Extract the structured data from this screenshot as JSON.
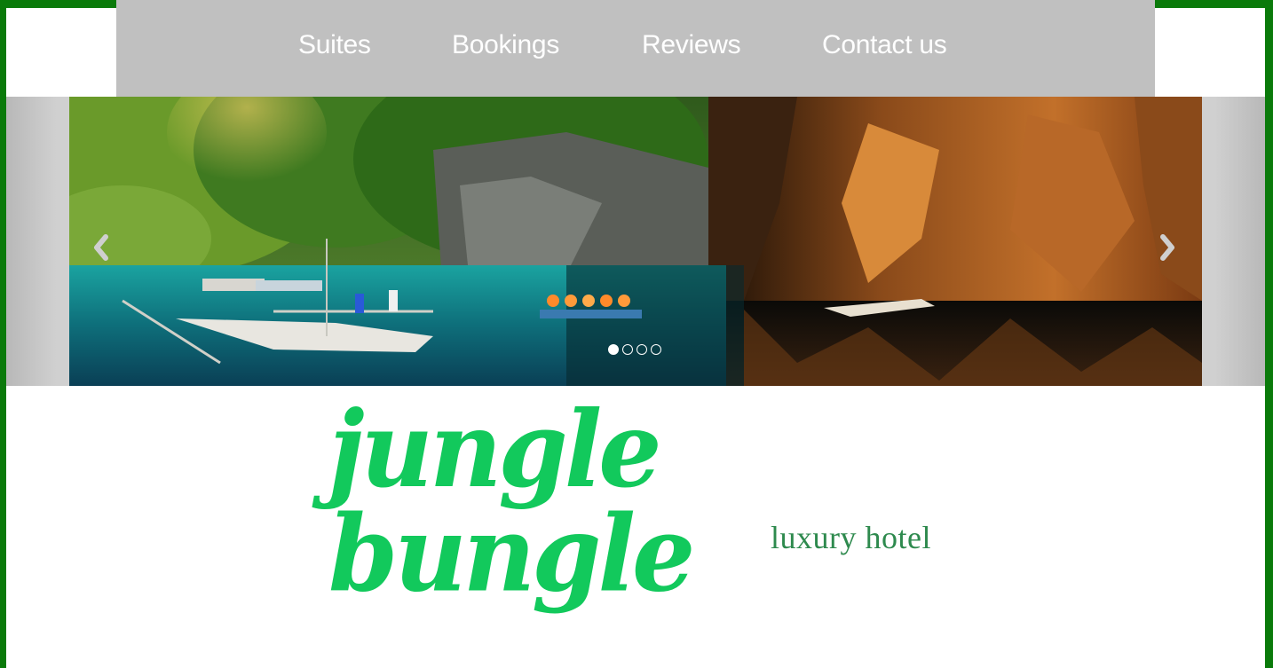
{
  "colors": {
    "frame": "#0a7a0a",
    "navbar_bg": "#c0c0c0",
    "nav_text": "#ffffff",
    "logo_green": "#12c95c",
    "tagline_green": "#2e8a4e"
  },
  "nav": {
    "items": [
      {
        "label": "Suites"
      },
      {
        "label": "Bookings"
      },
      {
        "label": "Reviews"
      },
      {
        "label": "Contact us"
      }
    ]
  },
  "carousel": {
    "prev_icon": "chevron-left-icon",
    "next_icon": "chevron-right-icon",
    "slide_count": 4,
    "active_index": 0
  },
  "brand": {
    "name": "jungle bungle",
    "tagline": "luxury hotel"
  }
}
